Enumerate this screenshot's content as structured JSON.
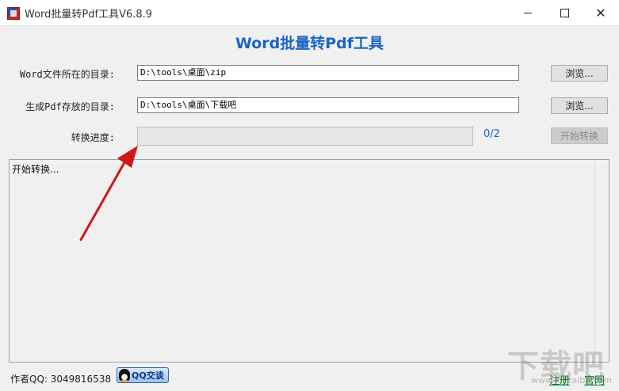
{
  "window": {
    "title": "Word批量转Pdf工具V6.8.9",
    "controls": {
      "minimize": "minimize",
      "maximize": "maximize",
      "close": "✕"
    }
  },
  "heading": "Word批量转Pdf工具",
  "source_dir": {
    "label": "Word文件所在的目录:",
    "value": "D:\\tools\\桌面\\zip",
    "browse_label": "浏览..."
  },
  "output_dir": {
    "label": "生成Pdf存放的目录:",
    "value": "D:\\tools\\桌面\\下载吧",
    "browse_label": "浏览..."
  },
  "progress": {
    "label": "转换进度:",
    "fraction": 0,
    "count_text": "0/2",
    "start_label": "开始转换"
  },
  "log": {
    "text": "开始转换..."
  },
  "footer": {
    "author": "作者QQ: 3049816538",
    "qq_button_label": "QQ交谈",
    "register_label": "注册",
    "website_label": "官网"
  },
  "watermark": {
    "main": "下载吧",
    "sub": "www.xiazaiba.com"
  },
  "colors": {
    "heading": "#1a63c9",
    "progress_count": "#1a63c9",
    "footer_links": "#0d7a2a",
    "annotation_arrow": "#d0161b"
  },
  "icons": {
    "app": "word-pdf-app-icon",
    "qq": "qq-penguin-icon"
  }
}
